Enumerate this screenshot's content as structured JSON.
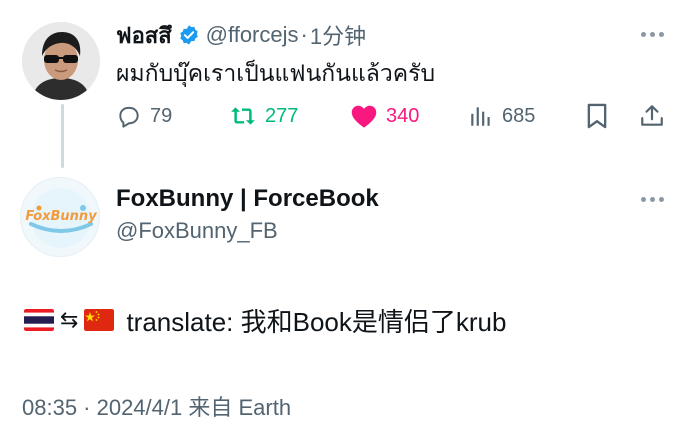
{
  "reply": {
    "display_name": "ฟอสสึ",
    "handle": "@fforcejs",
    "separator": "·",
    "time_ago": "1分钟",
    "text": "ผมกับบุ๊คเราเป็นแฟนกันแล้วครับ",
    "stats": {
      "replies": "79",
      "retweets": "277",
      "likes": "340",
      "views": "685"
    },
    "colors": {
      "retweet": "#00ba7c",
      "like": "#f91880",
      "verified": "#1d9bf0"
    }
  },
  "quoted": {
    "display_name": "FoxBunny | ForceBook",
    "handle": "@FoxBunny_FB",
    "avatar_logo_text": "FoxBunny",
    "text": "translate: 我和Book是情侣了krub",
    "flags": [
      "thailand-flag",
      "china-flag"
    ],
    "exchange_arrow": "⇆",
    "meta": "08:35 · 2024/4/1 来自 Earth"
  }
}
